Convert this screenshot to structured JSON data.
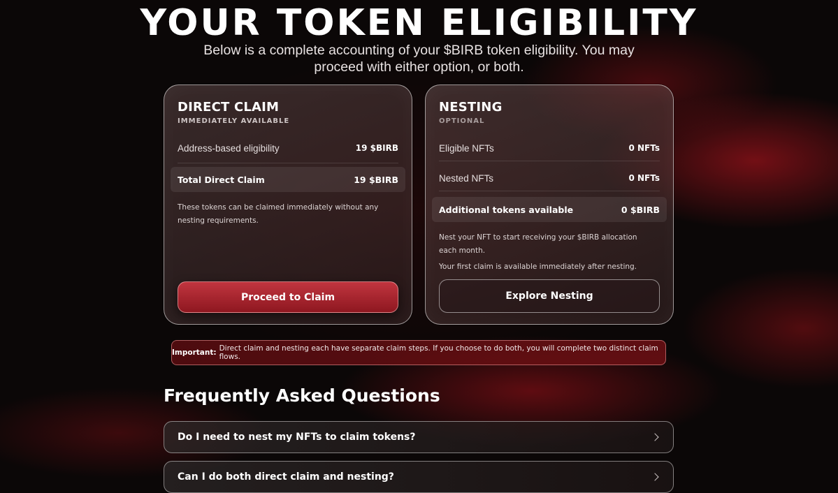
{
  "header": {
    "title": "YOUR TOKEN ELIGIBILITY",
    "subtitle": "Below is a complete accounting of your $BIRB token eligibility. You may proceed with either option, or both."
  },
  "direct_claim": {
    "title": "DIRECT CLAIM",
    "subtitle": "IMMEDIATELY AVAILABLE",
    "rows": [
      {
        "label": "Address-based eligibility",
        "value": "19 $BIRB"
      }
    ],
    "total": {
      "label": "Total Direct Claim",
      "value": "19 $BIRB"
    },
    "note": "These tokens can be claimed immediately without any nesting requirements.",
    "button_label": "Proceed to Claim"
  },
  "nesting": {
    "title": "NESTING",
    "subtitle": "OPTIONAL",
    "rows": [
      {
        "label": "Eligible NFTs",
        "value": "0 NFTs"
      },
      {
        "label": "Nested NFTs",
        "value": "0 NFTs"
      }
    ],
    "total": {
      "label": "Additional tokens available",
      "value": "0 $BIRB"
    },
    "note1": "Nest your NFT to start receiving your $BIRB allocation each month.",
    "note2": "Your first claim is available immediately after nesting.",
    "button_label": "Explore Nesting"
  },
  "important": {
    "label": "Important:",
    "text": "Direct claim and nesting each have separate claim steps. If you choose to do both, you will complete two distinct claim flows."
  },
  "faq": {
    "title": "Frequently Asked Questions",
    "items": [
      {
        "question": "Do I need to nest my NFTs to claim tokens?",
        "icon": "chevron-right-icon"
      },
      {
        "question": "Can I do both direct claim and nesting?",
        "icon": "chevron-right-icon"
      }
    ]
  },
  "colors": {
    "accent": "#b0262f",
    "background": "#0b0707"
  }
}
